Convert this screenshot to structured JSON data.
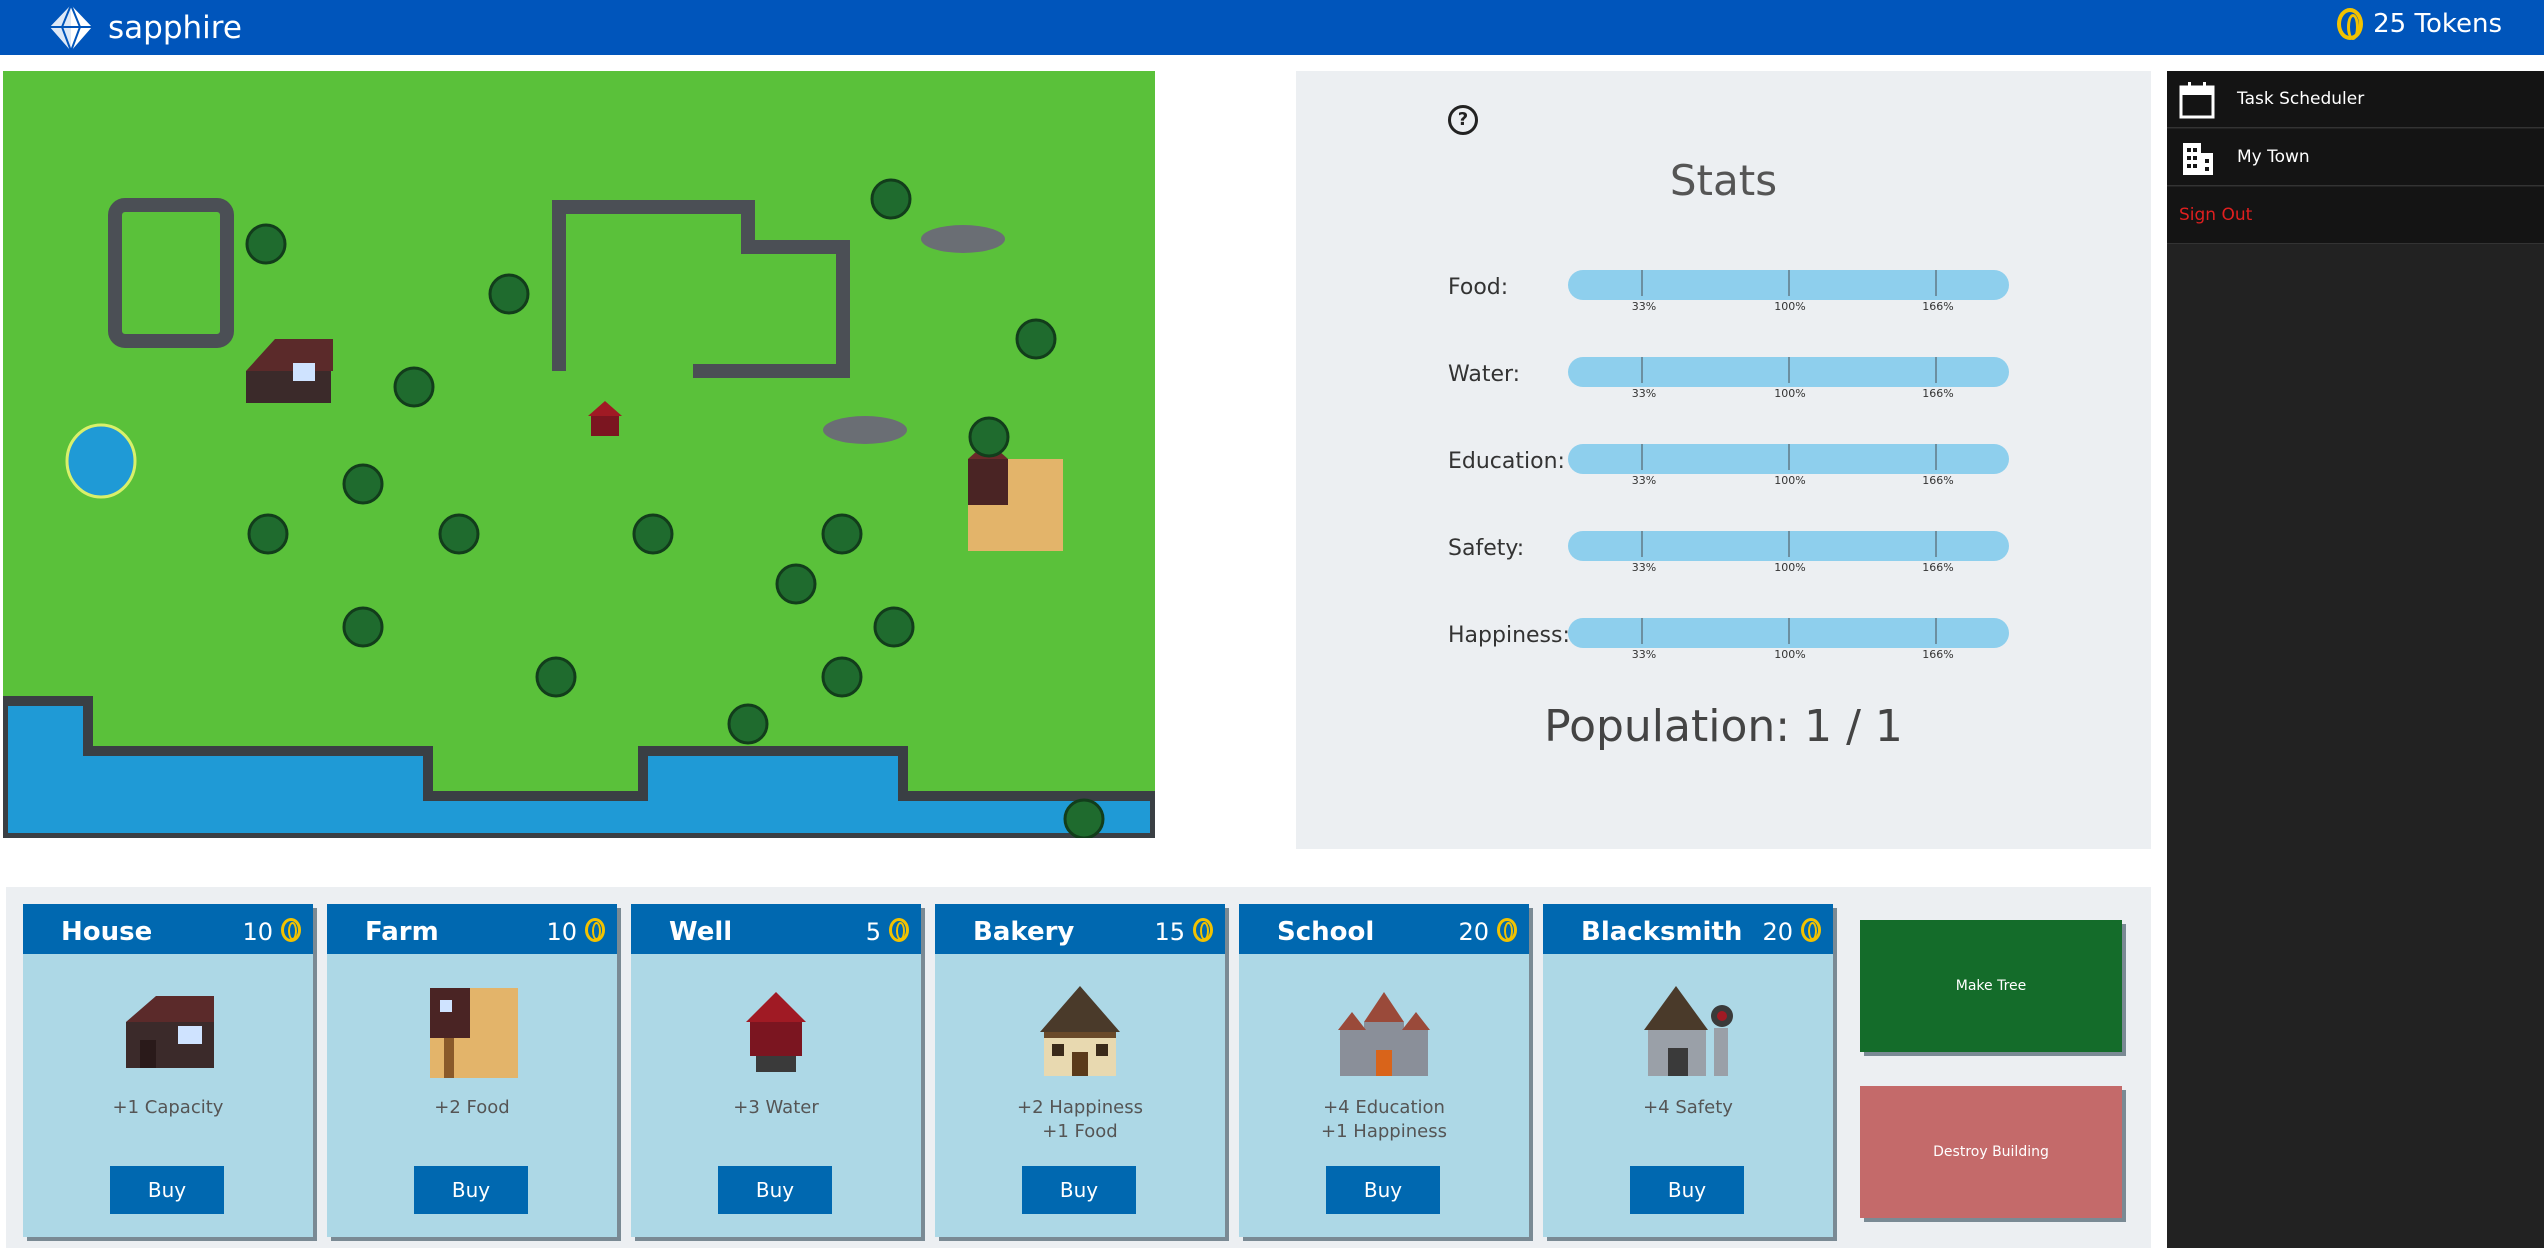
{
  "header": {
    "brand": "sapphire",
    "tokens": "25 Tokens"
  },
  "stats": {
    "title": "Stats",
    "help": "?",
    "rows": [
      {
        "label": "Food:",
        "level": 0.0
      },
      {
        "label": "Water:",
        "level": 0.0
      },
      {
        "label": "Education:",
        "level": 0.0
      },
      {
        "label": "Safety:",
        "level": 0.0
      },
      {
        "label": "Happiness:",
        "level": 0.0
      }
    ],
    "ticks": [
      "33%",
      "100%",
      "166%"
    ],
    "population": "Population: 1 / 1"
  },
  "sidebar": {
    "items": [
      {
        "label": "Task Scheduler",
        "icon": "calendar-icon"
      },
      {
        "label": "My Town",
        "icon": "buildings-icon"
      },
      {
        "label": "Sign Out"
      }
    ]
  },
  "shop": {
    "cards": [
      {
        "name": "House",
        "cost": "10",
        "desc1": "+1 Capacity",
        "desc2": "",
        "buy": "Buy"
      },
      {
        "name": "Farm",
        "cost": "10",
        "desc1": "+2 Food",
        "desc2": "",
        "buy": "Buy"
      },
      {
        "name": "Well",
        "cost": "5",
        "desc1": "+3 Water",
        "desc2": "",
        "buy": "Buy"
      },
      {
        "name": "Bakery",
        "cost": "15",
        "desc1": "+2 Happiness",
        "desc2": "+1 Food",
        "buy": "Buy"
      },
      {
        "name": "School",
        "cost": "20",
        "desc1": "+4 Education",
        "desc2": "+1 Happiness",
        "buy": "Buy"
      },
      {
        "name": "Blacksmith",
        "cost": "20",
        "desc1": "+4 Safety",
        "desc2": "",
        "buy": "Buy"
      }
    ],
    "make_tree": "Make Tree",
    "destroy_building": "Destroy Building"
  },
  "colors": {
    "header": "#0055bb",
    "grass": "#5ac13a",
    "water": "#1f9ad6",
    "card": "#add8e6",
    "card_header": "#0068b0",
    "make_tree": "#146c2a",
    "destroy": "#c46a6a",
    "sign_out": "#e01f1f"
  }
}
